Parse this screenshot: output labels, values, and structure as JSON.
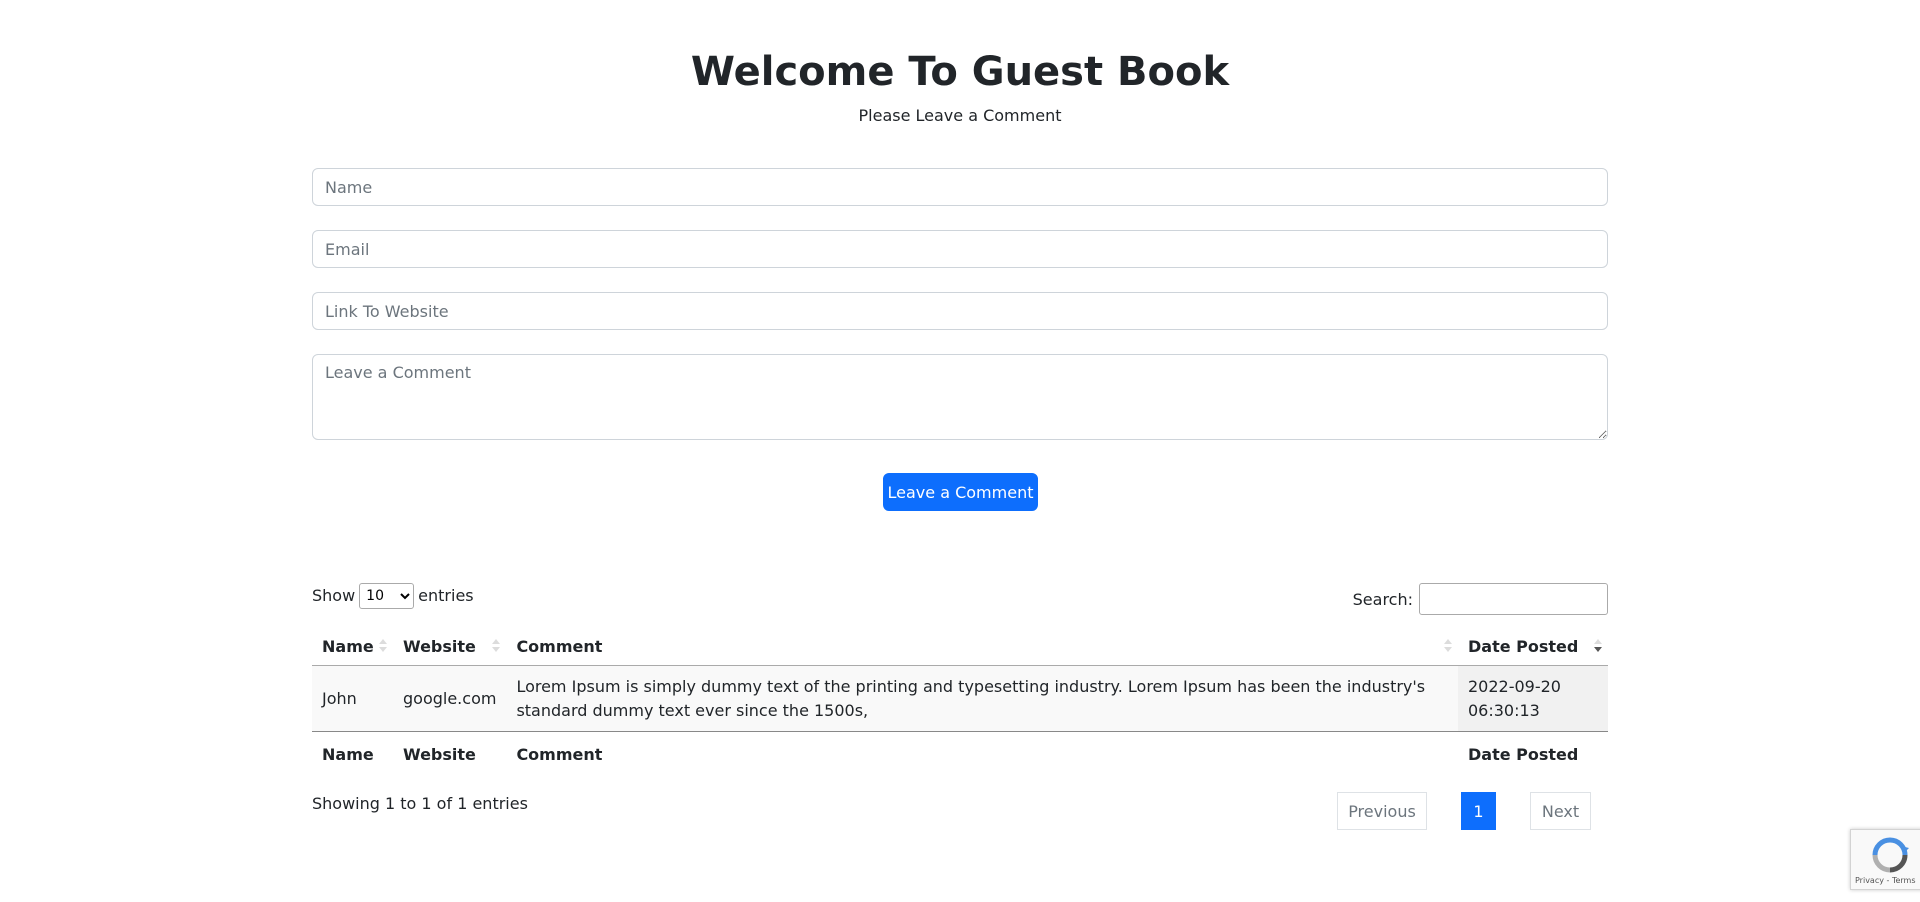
{
  "header": {
    "title": "Welcome To Guest Book",
    "subtitle": "Please Leave a Comment"
  },
  "form": {
    "name_placeholder": "Name",
    "email_placeholder": "Email",
    "website_placeholder": "Link To Website",
    "comment_placeholder": "Leave a Comment",
    "submit_label": "Leave a Comment"
  },
  "datatable": {
    "length_prefix": "Show",
    "length_value": "10",
    "length_suffix": "entries",
    "search_label": "Search:",
    "search_value": "",
    "columns": [
      "Name",
      "Website",
      "Comment",
      "Date Posted"
    ],
    "sorted_column": "Date Posted",
    "sort_direction": "desc",
    "rows": [
      {
        "name": "John",
        "website": "google.com",
        "comment": "Lorem Ipsum is simply dummy text of the printing and typesetting industry. Lorem Ipsum has been the industry's standard dummy text ever since the 1500s,",
        "date_posted": "2022-09-20 06:30:13"
      }
    ],
    "info": "Showing 1 to 1 of 1 entries",
    "pagination": {
      "previous_label": "Previous",
      "current_page": "1",
      "next_label": "Next"
    }
  },
  "recaptcha": {
    "links_text": "Privacy - Terms",
    "icon": "recaptcha-icon"
  },
  "colors": {
    "primary": "#0d6efd",
    "text": "#212529",
    "muted": "#6c757d"
  }
}
